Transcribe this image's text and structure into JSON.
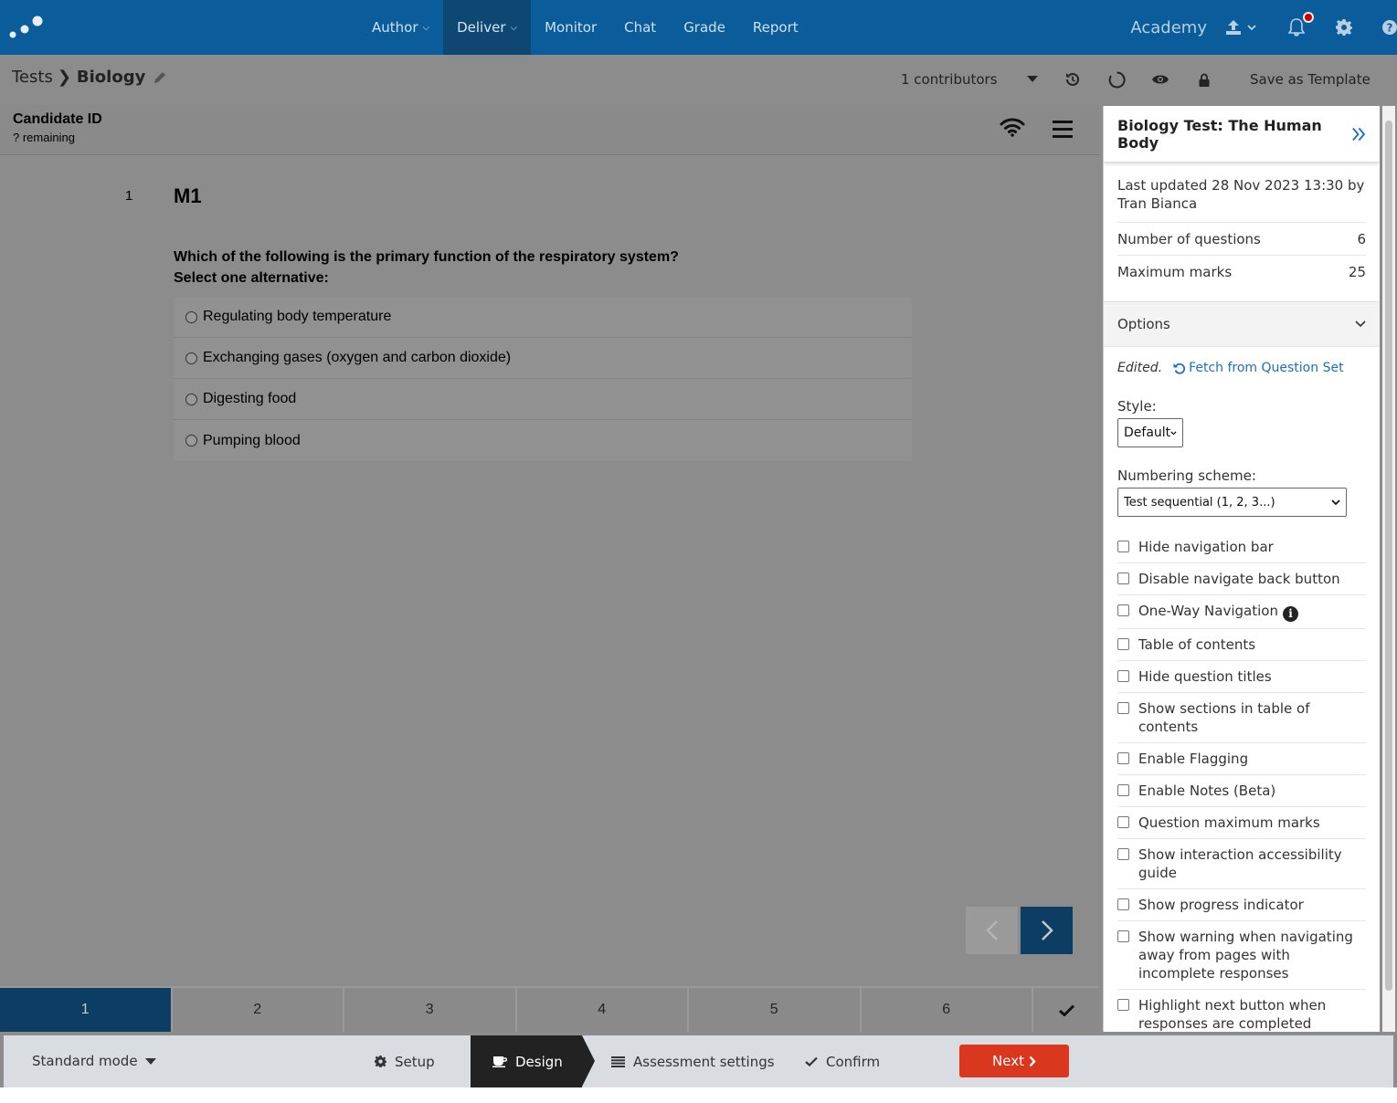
{
  "topnav": {
    "items": [
      {
        "label": "Author",
        "dropdown": true
      },
      {
        "label": "Deliver",
        "dropdown": true,
        "active": true
      },
      {
        "label": "Monitor"
      },
      {
        "label": "Chat"
      },
      {
        "label": "Grade"
      },
      {
        "label": "Report"
      }
    ],
    "academy": "Academy",
    "icons": [
      "upload-icon",
      "bell-icon",
      "gear-icon",
      "help-icon"
    ]
  },
  "subbar": {
    "crumb_root": "Tests",
    "crumb_current": "Biology",
    "contributors": "1 contributors",
    "save_template": "Save as Template"
  },
  "preview": {
    "candidate_title": "Candidate ID",
    "remaining": "? remaining",
    "question_number": "1",
    "question_title": "M1",
    "question_text": "Which of the following is the primary function of the respiratory system?",
    "instruction": "Select one alternative:",
    "alternatives": [
      "Regulating body temperature",
      "Exchanging gases (oxygen and carbon dioxide)",
      "Digesting food",
      "Pumping blood"
    ],
    "nav_pages": [
      "1",
      "2",
      "3",
      "4",
      "5",
      "6"
    ]
  },
  "panel": {
    "title": "Biology Test: The Human Body",
    "updated": "Last updated 28 Nov 2023 13:30 by Tran Bianca",
    "num_questions_label": "Number of questions",
    "num_questions": "6",
    "max_marks_label": "Maximum marks",
    "max_marks": "25",
    "options_label": "Options",
    "edited": "Edited.",
    "fetch": "Fetch from Question Set",
    "style_label": "Style:",
    "style_value": "Default",
    "numbering_label": "Numbering scheme:",
    "numbering_value": "Test sequential (1, 2, 3...)",
    "checkboxes": [
      "Hide navigation bar",
      "Disable navigate back button",
      "One-Way Navigation",
      "Table of contents",
      "Hide question titles",
      "Show sections in table of contents",
      "Enable Flagging",
      "Enable Notes (Beta)",
      "Question maximum marks",
      "Show interaction accessibility guide",
      "Show progress indicator",
      "Show warning when navigating away from pages with incomplete responses",
      "Highlight next button when responses are completed"
    ]
  },
  "wizard": {
    "mode": "Standard mode",
    "steps": [
      "Setup",
      "Design",
      "Assessment settings",
      "Confirm"
    ],
    "next": "Next"
  },
  "colors": {
    "nav_bg": "#0a5d9a",
    "accent_dark": "#0c3d63",
    "next_button": "#d9381e",
    "link": "#1a6fc4"
  }
}
